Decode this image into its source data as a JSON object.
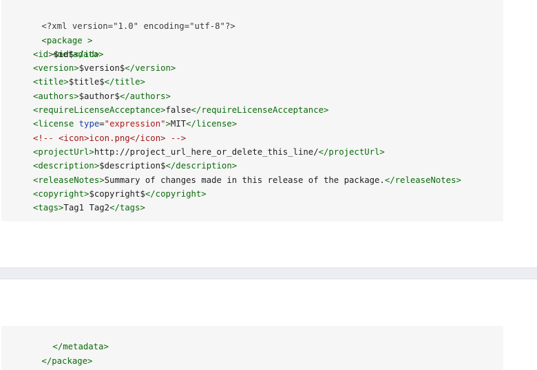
{
  "code_top": {
    "decl": "<?xml version=\"1.0\" encoding=\"utf-8\"?>",
    "package_open": "<package >",
    "metadata_open": "<metadata>",
    "id": {
      "open": "<id>",
      "text": "$id$",
      "close": "</id>"
    },
    "version": {
      "open": "<version>",
      "text": "$version$",
      "close": "</version>"
    },
    "title": {
      "open": "<title>",
      "text": "$title$",
      "close": "</title>"
    },
    "authors": {
      "open": "<authors>",
      "text": "$author$",
      "close": "</authors>"
    },
    "requireLicenseAcceptance": {
      "open": "<requireLicenseAcceptance>",
      "text": "false",
      "close": "</requireLicenseAcceptance>"
    },
    "license": {
      "open_start": "<license ",
      "attr_name": "type",
      "eq": "=",
      "attr_value": "\"expression\"",
      "open_end": ">",
      "text": "MIT",
      "close": "</license>"
    },
    "comment": {
      "start": "<!-- ",
      "icon_open": "<icon>",
      "icon_text": "icon.png",
      "icon_close": "</icon>",
      "end": " -->"
    },
    "projectUrl": {
      "open": "<projectUrl>",
      "text": "http://project_url_here_or_delete_this_line/",
      "close": "</projectUrl>"
    },
    "description": {
      "open": "<description>",
      "text": "$description$",
      "close": "</description>"
    },
    "releaseNotes": {
      "open": "<releaseNotes>",
      "text": "Summary of changes made in this release of the package.",
      "close": "</releaseNotes>"
    },
    "copyright": {
      "open": "<copyright>",
      "text": "$copyright$",
      "close": "</copyright>"
    },
    "tags": {
      "open": "<tags>",
      "text": "Tag1 Tag2",
      "close": "</tags>"
    }
  },
  "code_bottom": {
    "metadata_close": "</metadata>",
    "package_close": "</package>"
  }
}
